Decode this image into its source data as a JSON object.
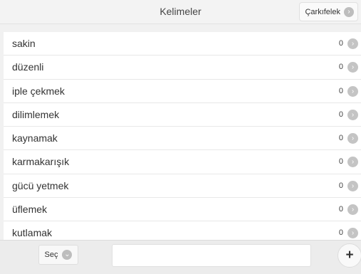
{
  "header": {
    "title": "Kelimeler",
    "wheel_button_label": "Çarkıfelek",
    "wheel_button_icon": "chevron-right-icon"
  },
  "words": [
    {
      "word": "sakin",
      "count": "0"
    },
    {
      "word": "düzenli",
      "count": "0"
    },
    {
      "word": "iple çekmek",
      "count": "0"
    },
    {
      "word": "dilimlemek",
      "count": "0"
    },
    {
      "word": "kaynamak",
      "count": "0"
    },
    {
      "word": "karmakarışık",
      "count": "0"
    },
    {
      "word": "gücü yetmek",
      "count": "0"
    },
    {
      "word": "üflemek",
      "count": "0"
    },
    {
      "word": "kutlamak",
      "count": "0"
    }
  ],
  "footer": {
    "select_label": "Seç",
    "select_icon": "chevron-down-icon",
    "input_value": "",
    "input_placeholder": "",
    "add_label": "+"
  },
  "colors": {
    "background": "#f1f1f1",
    "icon_gray": "#c4c4c4"
  }
}
